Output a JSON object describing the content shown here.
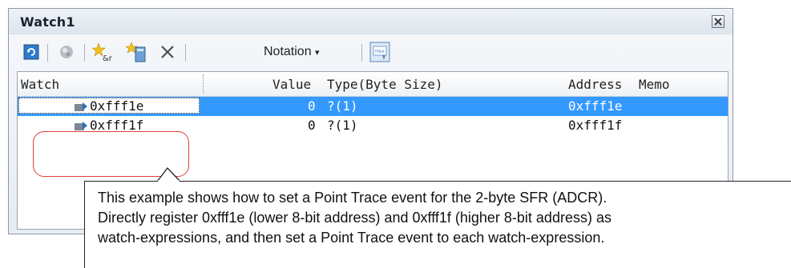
{
  "window": {
    "title": "Watch1"
  },
  "toolbar": {
    "notation_label": "Notation",
    "icons": [
      "refresh-icon",
      "gem-icon",
      "add-watch-icon",
      "add-watch-expression-icon",
      "delete-icon",
      "notation-dropdown-icon",
      "hex-display-icon"
    ]
  },
  "grid": {
    "columns": [
      "Watch",
      "Value",
      "Type(Byte Size)",
      "Address",
      "Memo"
    ],
    "rows": [
      {
        "watch": "0xfff1e",
        "value": "0",
        "type": "?(1)",
        "address": "0xfff1e",
        "memo": "",
        "selected": true
      },
      {
        "watch": "0xfff1f",
        "value": "0",
        "type": "?(1)",
        "address": "0xfff1f",
        "memo": "",
        "selected": false
      }
    ]
  },
  "callout": {
    "text": "This example shows how to set a Point Trace event for the 2-byte SFR (ADCR). Directly register 0xfff1e (lower 8-bit address) and 0xfff1f (higher 8-bit address) as watch-expressions, and then set a Point Trace event to each watch-expression.",
    "line1": "This example shows how to set a Point Trace event for the 2-byte SFR (ADCR).",
    "line2": "Directly register 0xfff1e (lower 8-bit address) and 0xfff1f (higher 8-bit address) as",
    "line3": "watch-expressions, and then set a Point Trace event to each watch-expression."
  },
  "colors": {
    "selection": "#3399ff",
    "callout_ring": "#e23b3b",
    "panel_border": "#8c99aa"
  }
}
